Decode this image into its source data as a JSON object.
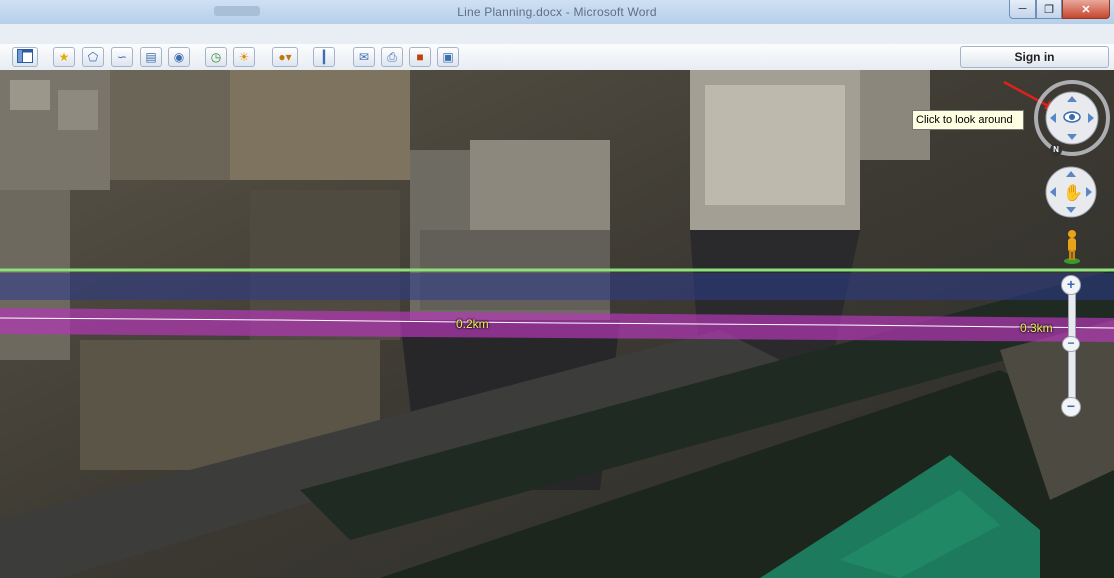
{
  "window": {
    "title": "Line Planning.docx - Microsoft Word"
  },
  "toolbar": {
    "buttons": [
      {
        "name": "sidebar-toggle-button",
        "icon": "sidebar-icon"
      },
      {
        "name": "add-placemark-button",
        "icon": "pin-icon"
      },
      {
        "name": "add-polygon-button",
        "icon": "polygon-icon"
      },
      {
        "name": "add-path-button",
        "icon": "path-icon"
      },
      {
        "name": "add-image-overlay-button",
        "icon": "overlay-icon"
      },
      {
        "name": "record-tour-button",
        "icon": "tour-icon"
      },
      {
        "name": "historical-imagery-button",
        "icon": "clock-icon"
      },
      {
        "name": "sunlight-button",
        "icon": "sun-icon"
      },
      {
        "name": "switch-planet-button",
        "icon": "planet-icon"
      },
      {
        "name": "ruler-button",
        "icon": "ruler-icon"
      },
      {
        "name": "email-button",
        "icon": "email-icon"
      },
      {
        "name": "print-button",
        "icon": "print-icon"
      },
      {
        "name": "view-in-maps-button",
        "icon": "maps-icon"
      },
      {
        "name": "save-image-button",
        "icon": "image-icon"
      }
    ],
    "sign_in_label": "Sign in"
  },
  "map": {
    "distance_labels": [
      "0.2km",
      "0.3km"
    ],
    "route_color": "#b437b7",
    "boundary_color": "#8ee07c",
    "band_color": "#3a3f8a"
  },
  "navigation": {
    "tooltip": "Click to look around",
    "compass_north_label": "N"
  }
}
